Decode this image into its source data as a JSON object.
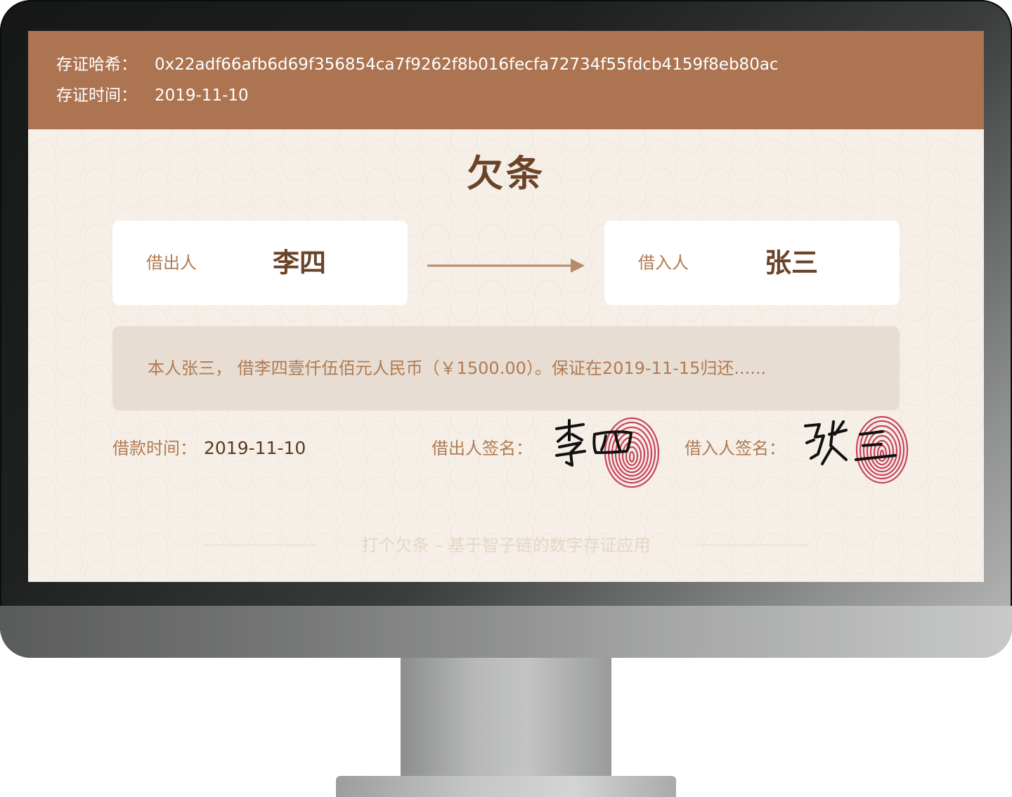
{
  "header": {
    "hash_label": "存证哈希：",
    "hash_value": "0x22adf66afb6d69f356854ca7f9262f8b016fecfa72734f55fdcb4159f8eb80ac",
    "time_label": "存证时间：",
    "time_value": "2019-11-10"
  },
  "document": {
    "title": "欠条",
    "lender": {
      "role": "借出人",
      "name": "李四"
    },
    "borrower": {
      "role": "借入人",
      "name": "张三"
    },
    "terms": "本人张三， 借李四壹仟伍佰元人民币（￥1500.00）。保证在2019-11-15归还......",
    "loan_time_label": "借款时间：",
    "loan_time_value": "2019-11-10",
    "lender_sign_label": "借出人签名：",
    "lender_signature": "李四",
    "borrower_sign_label": "借入人签名：",
    "borrower_signature": "张三"
  },
  "footer": {
    "text": "打个欠条 – 基于智子链的数字存证应用"
  },
  "colors": {
    "header_bg": "#ac7451",
    "paper_bg": "#f5efe7",
    "accent_brown": "#b07b52",
    "dark_brown": "#6b4327",
    "terms_bg": "#e8ddd2",
    "fingerprint_red": "#c4314b"
  },
  "icons": [
    "arrow-right-icon",
    "fingerprint-icon",
    "signature"
  ]
}
